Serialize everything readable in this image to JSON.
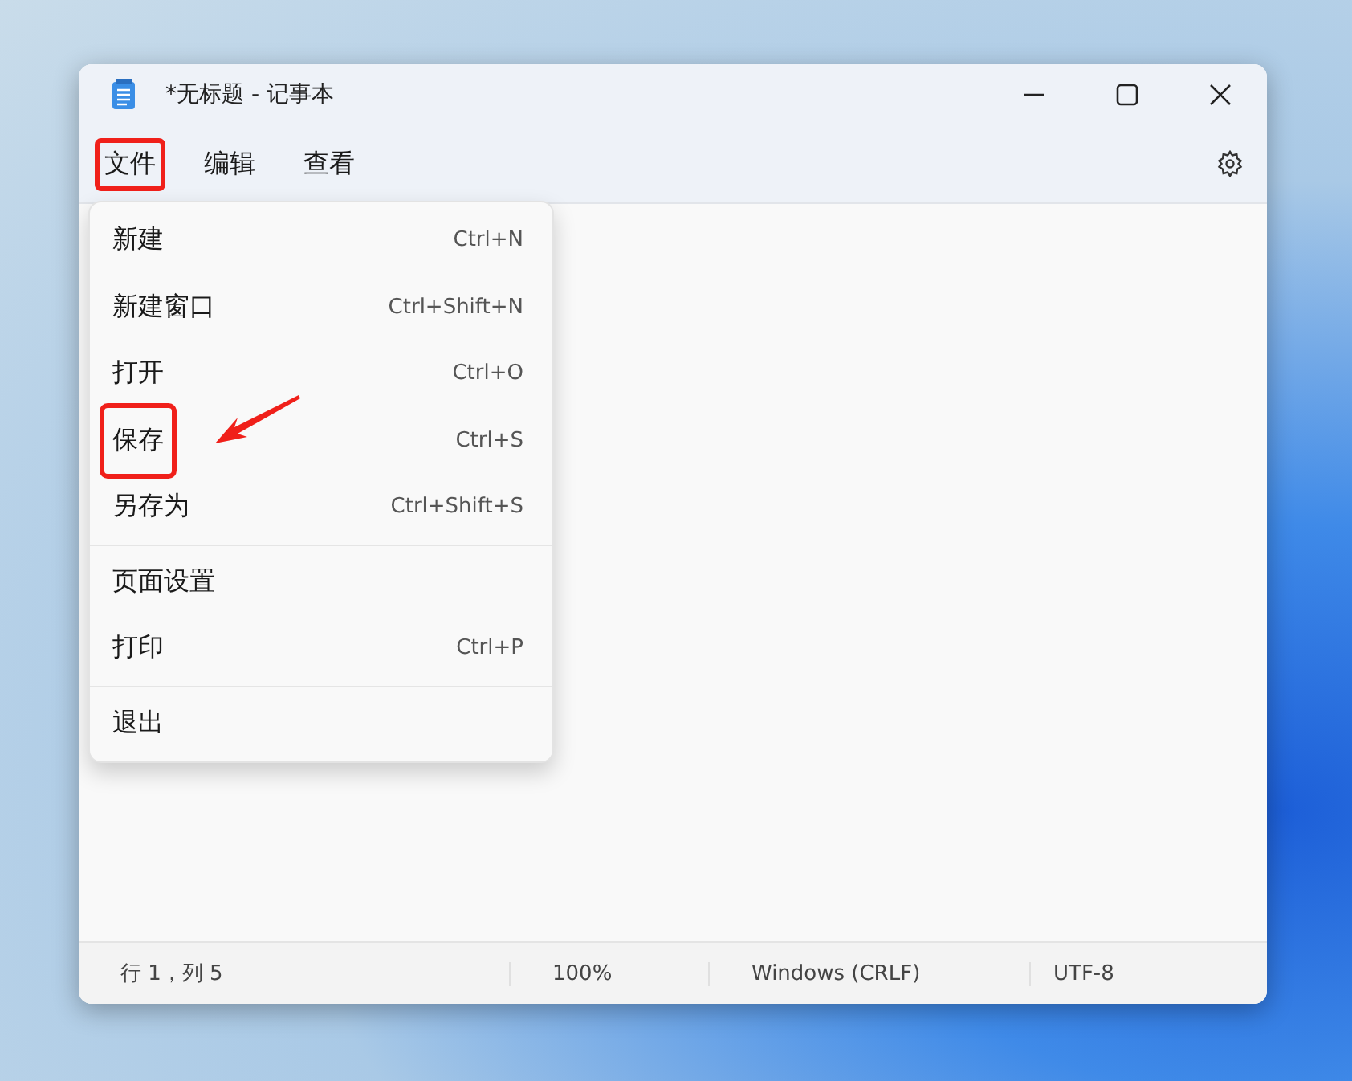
{
  "window": {
    "title": "*无标题 - 记事本"
  },
  "menubar": [
    {
      "label": "文件",
      "highlighted": true
    },
    {
      "label": "编辑",
      "highlighted": false
    },
    {
      "label": "查看",
      "highlighted": false
    }
  ],
  "menu": {
    "sections": [
      {
        "items": [
          {
            "label": "新建",
            "shortcut": "Ctrl+N",
            "highlighted": false
          },
          {
            "label": "新建窗口",
            "shortcut": "Ctrl+Shift+N",
            "highlighted": false
          },
          {
            "label": "打开",
            "shortcut": "Ctrl+O",
            "highlighted": false
          },
          {
            "label": "保存",
            "shortcut": "Ctrl+S",
            "highlighted": true
          },
          {
            "label": "另存为",
            "shortcut": "Ctrl+Shift+S",
            "highlighted": false
          }
        ]
      },
      {
        "items": [
          {
            "label": "页面设置",
            "highlighted": false
          },
          {
            "label": "打印",
            "shortcut": "Ctrl+P",
            "highlighted": false
          }
        ]
      },
      {
        "items": [
          {
            "label": "退出",
            "highlighted": false
          }
        ]
      }
    ]
  },
  "status_bar": {
    "position": "行 1，列 5",
    "zoom": "100%",
    "line_ending": "Windows (CRLF)",
    "encoding": "UTF-8"
  }
}
